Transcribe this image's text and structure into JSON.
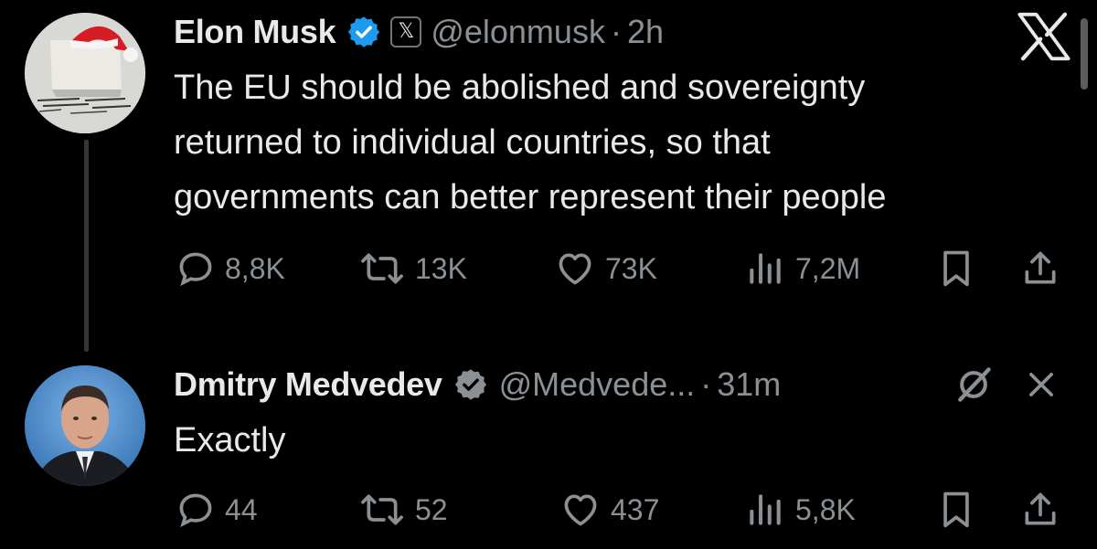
{
  "tweets": [
    {
      "author": "Elon Musk",
      "handle": "@elonmusk",
      "separator": "·",
      "time": "2h",
      "affiliate_label": "𝕏",
      "text_lines": [
        "The EU should be abolished and sovereignty",
        "returned to individual countries, so that",
        "governments can better represent their people"
      ],
      "stats": {
        "replies": "8,8K",
        "reposts": "13K",
        "likes": "73K",
        "views": "7,2M"
      }
    },
    {
      "author": "Dmitry Medvedev",
      "handle": "@Medvede...",
      "separator": "·",
      "time": "31m",
      "text_lines": [
        "Exactly"
      ],
      "stats": {
        "replies": "44",
        "reposts": "52",
        "likes": "437",
        "views": "5,8K"
      }
    }
  ],
  "colors": {
    "background": "#000000",
    "text": "#e7e9ea",
    "muted": "#8b9095",
    "verified": "#1d9bf0"
  },
  "icons": [
    "x-logo-icon",
    "close-icon",
    "grok-icon",
    "reply-icon",
    "repost-icon",
    "like-icon",
    "views-icon",
    "bookmark-icon",
    "share-icon",
    "verified-badge-icon"
  ]
}
